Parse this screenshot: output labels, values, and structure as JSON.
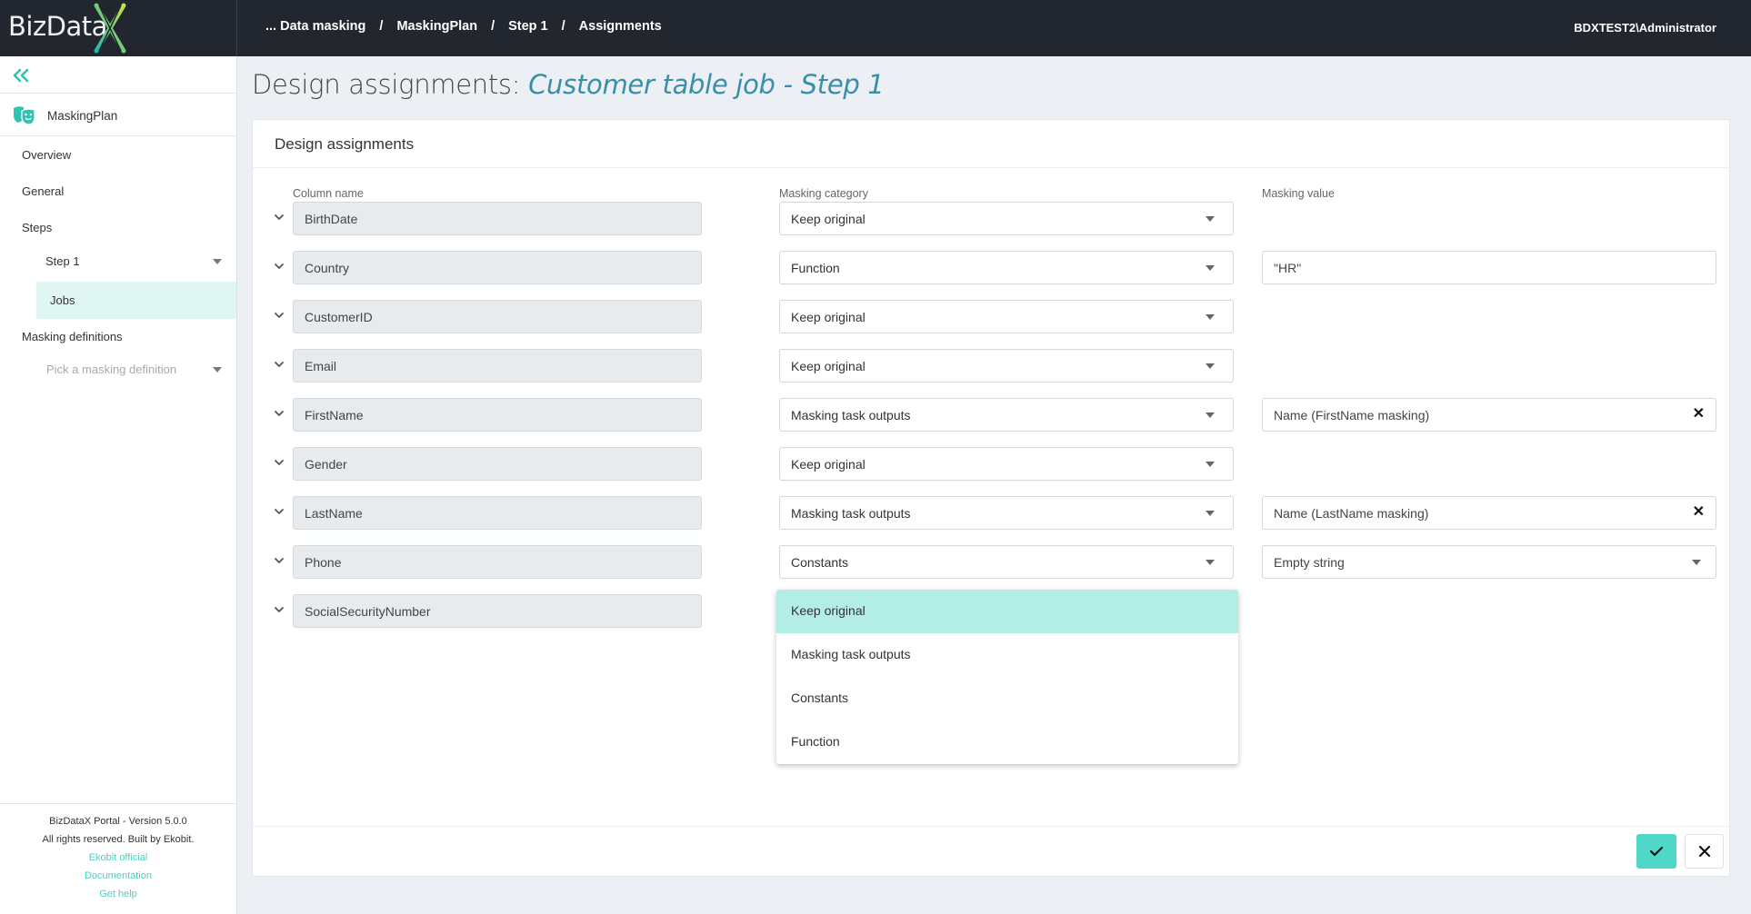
{
  "app": {
    "logo_text": "BizData",
    "user": "BDXTEST2\\Administrator"
  },
  "breadcrumb": [
    {
      "label": "... Data masking"
    },
    {
      "label": "MaskingPlan"
    },
    {
      "label": "Step 1"
    },
    {
      "label": "Assignments"
    }
  ],
  "breadcrumb_separator": "/",
  "sidebar": {
    "collapse_icon": "double-chevron-left-icon",
    "plan_label": "MaskingPlan",
    "plan_icon": "theater-masks-icon",
    "items": {
      "overview": "Overview",
      "general": "General",
      "steps": "Steps",
      "step1": "Step 1",
      "jobs": "Jobs",
      "masking_definitions": "Masking definitions",
      "pick_definition_placeholder": "Pick a masking definition"
    },
    "footer": {
      "version": "BizDataX Portal - Version 5.0.0",
      "rights": "All rights reserved. Built by Ekobit.",
      "links": [
        "Ekobit official",
        "Documentation",
        "Get help"
      ]
    }
  },
  "page": {
    "title_prefix": "Design assignments: ",
    "title_job": "Customer table job - Step 1"
  },
  "card": {
    "title": "Design assignments",
    "columns": {
      "column_name": "Column name",
      "masking_category": "Masking category",
      "masking_value": "Masking value"
    },
    "rows": [
      {
        "column": "BirthDate",
        "category": "Keep original",
        "value": null,
        "value_type": "none"
      },
      {
        "column": "Country",
        "category": "Function",
        "value": "\"HR\"",
        "value_type": "text"
      },
      {
        "column": "CustomerID",
        "category": "Keep original",
        "value": null,
        "value_type": "none"
      },
      {
        "column": "Email",
        "category": "Keep original",
        "value": null,
        "value_type": "none"
      },
      {
        "column": "FirstName",
        "category": "Masking task outputs",
        "value": "Name (FirstName masking)",
        "value_type": "clearable"
      },
      {
        "column": "Gender",
        "category": "Keep original",
        "value": null,
        "value_type": "none"
      },
      {
        "column": "LastName",
        "category": "Masking task outputs",
        "value": "Name (LastName masking)",
        "value_type": "clearable"
      },
      {
        "column": "Phone",
        "category": "Constants",
        "value": "Empty string",
        "value_type": "select"
      },
      {
        "column": "SocialSecurityNumber",
        "category": "Keep original",
        "value": null,
        "value_type": "none"
      }
    ],
    "open_dropdown": {
      "row": "SocialSecurityNumber",
      "options": [
        "Keep original",
        "Masking task outputs",
        "Constants",
        "Function"
      ],
      "highlighted": "Keep original"
    },
    "actions": {
      "save_icon": "checkmark-icon",
      "cancel_icon": "close-icon"
    }
  },
  "colors": {
    "accent": "#4fd8c8",
    "topbar": "#22262f",
    "title_italic": "#3a8fa8",
    "highlight": "#b2ede6"
  }
}
